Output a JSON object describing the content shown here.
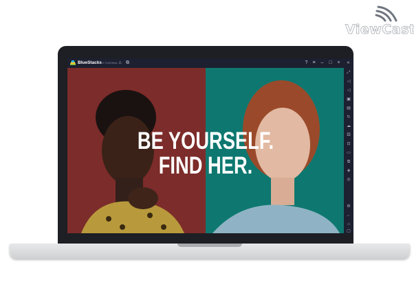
{
  "watermark": {
    "text": "ViewCast",
    "icon": "wifi-waves-icon"
  },
  "app": {
    "name": "BlueStacks",
    "version": "5.0.0.7228 Beta",
    "icons": {
      "titlebar_left": [
        "home-icon",
        "multi-instance-icon"
      ],
      "titlebar_right": [
        "help-icon",
        "menu-icon",
        "minimize-icon",
        "restore-icon",
        "close-icon",
        "collapse-sidebar-icon"
      ],
      "sidebar": [
        "fullscreen-icon",
        "volume-up-icon",
        "volume-down-icon",
        "screen-record-icon",
        "keyboard-icon",
        "rotate-icon",
        "shake-icon",
        "gamepad-icon",
        "screenshot-icon",
        "folder-icon",
        "multi-instance-icon",
        "eco-mode-icon",
        "macro-icon",
        "settings-icon",
        "back-icon",
        "home-icon",
        "recent-apps-icon"
      ]
    }
  },
  "content": {
    "headline_line1": "BE YOURSELF.",
    "headline_line2": "FIND HER."
  },
  "colors": {
    "left_panel": "#7c2c2a",
    "right_panel": "#0e7870",
    "titlebar": "#1c2030"
  }
}
